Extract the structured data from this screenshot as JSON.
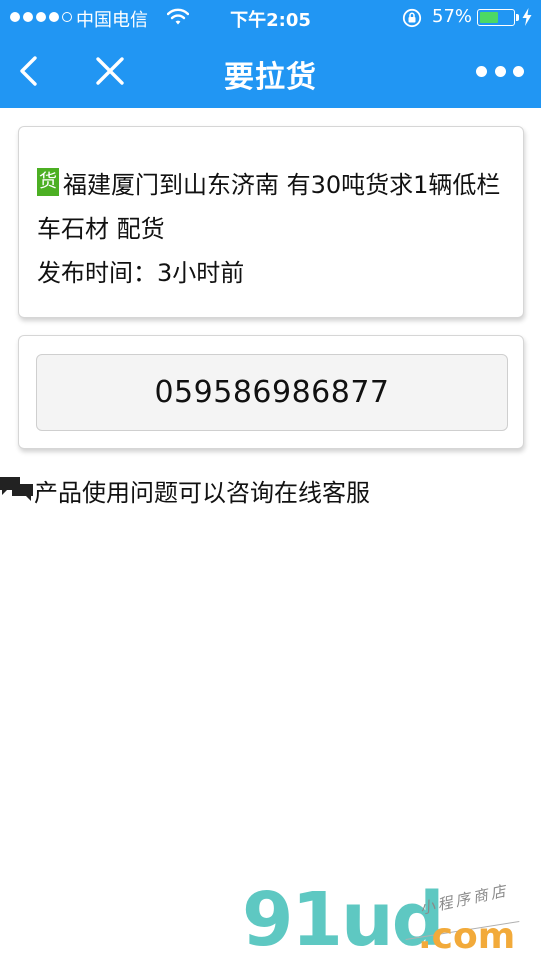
{
  "status_bar": {
    "carrier": "中国电信",
    "time": "下午2:05",
    "battery_percent": "57%",
    "battery_level": 0.57,
    "signal_bars_filled": 4,
    "signal_bars_total": 5
  },
  "nav": {
    "title": "要拉货"
  },
  "listing": {
    "badge": "货",
    "description": "福建厦门到山东济南 有30吨货求1辆低栏车石材 配货",
    "publish_time": "发布时间：3小时前"
  },
  "contact": {
    "phone": "059586986877"
  },
  "service": {
    "text": "产品使用问题可以咨询在线客服"
  },
  "watermark": {
    "logo": "91ud",
    "tld": ".com",
    "tagline": "小程序商店"
  },
  "colors": {
    "nav_blue": "#2196f3",
    "badge_green": "#4caf23",
    "battery_green": "#4cd964",
    "watermark_teal": "#5ec8c2",
    "watermark_orange": "#f2aa3a"
  },
  "icons": [
    "chevron-left-icon",
    "close-icon",
    "more-icon",
    "wifi-icon",
    "lock-rotation-icon",
    "charging-bolt-icon",
    "chat-bubbles-icon"
  ]
}
